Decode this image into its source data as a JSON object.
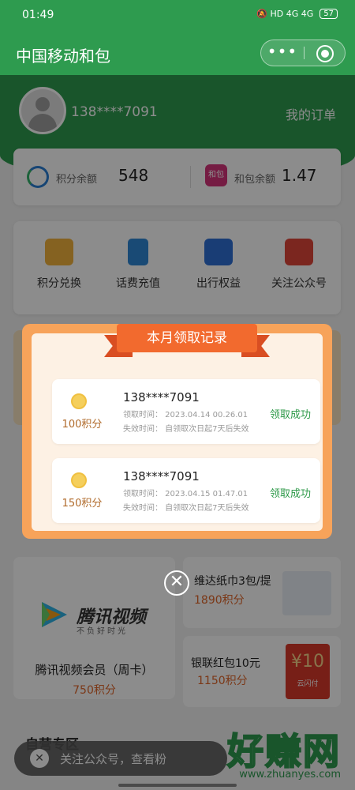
{
  "status_bar": {
    "time": "01:49",
    "indicators": "🔕 HD 4G 4G",
    "battery": "57"
  },
  "header": {
    "title": "中国移动和包",
    "more_icon": "more-dots-icon",
    "close_icon": "circle-target-icon"
  },
  "profile": {
    "phone": "138****7091",
    "orders_label": "我的订单"
  },
  "balance": {
    "points_label": "积分余额",
    "points_value": "548",
    "hebao_icon_text": "和包",
    "hebao_label": "和包余额",
    "hebao_value": "1.47"
  },
  "services": [
    {
      "label": "积分兑换",
      "icon": "ticket-icon",
      "color": "#e8a62e"
    },
    {
      "label": "话费充值",
      "icon": "phone-icon",
      "color": "#2f87d6"
    },
    {
      "label": "出行权益",
      "icon": "nfc-card-icon",
      "color": "#2f6fd6"
    },
    {
      "label": "关注公众号",
      "icon": "calendar-check-icon",
      "color": "#e0453a"
    }
  ],
  "products": {
    "tencent": {
      "logo_name": "腾讯视频",
      "slogan": "不负好时光",
      "title": "腾讯视频会员（周卡）",
      "price": "750积分"
    },
    "tissue": {
      "title": "维达纸巾3包/提",
      "price": "1890积分"
    },
    "unionpay": {
      "title": "银联红包10元",
      "price": "1150积分",
      "envelope_value": "¥10",
      "envelope_sub": "云闪付"
    }
  },
  "section": {
    "title": "自营专区"
  },
  "toast": {
    "text": "关注公众号，查看粉"
  },
  "watermark": {
    "main": "好赚网",
    "sub": "www.zhuanyes.com"
  },
  "modal": {
    "title": "本月领取记录",
    "records": [
      {
        "points": "100积分",
        "phone": "138****7091",
        "time": "领取时间： 2023.04.14 00.26.01",
        "expire": "失效时间： 自领取次日起7天后失效",
        "status": "领取成功"
      },
      {
        "points": "150积分",
        "phone": "138****7091",
        "time": "领取时间： 2023.04.15 01.47.01",
        "expire": "失效时间： 自领取次日起7天后失效",
        "status": "领取成功"
      }
    ],
    "close_symbol": "✕"
  }
}
